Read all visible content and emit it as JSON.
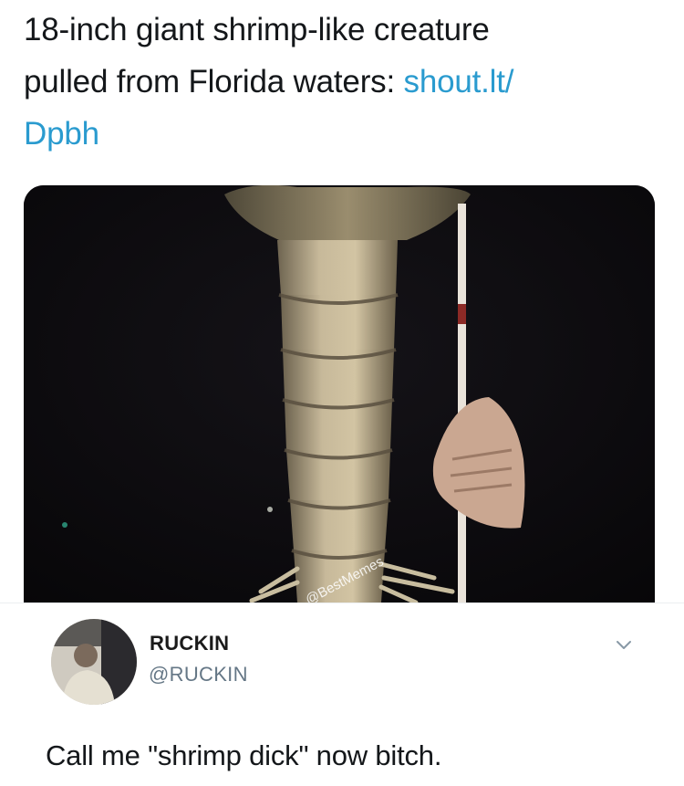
{
  "tweet": {
    "text_line1": "18-inch giant shrimp-like creature",
    "text_line2": "pulled from Florida waters: ",
    "link_part1": "shout.lt/",
    "link_part2": "Dpbh"
  },
  "photo": {
    "watermark": "@BestMemes"
  },
  "reply": {
    "name": "RUCKIN",
    "handle": "@RUCKIN",
    "text": "Call me \"shrimp dick\" now bitch.",
    "chevron_icon": "chevron-down-icon"
  }
}
